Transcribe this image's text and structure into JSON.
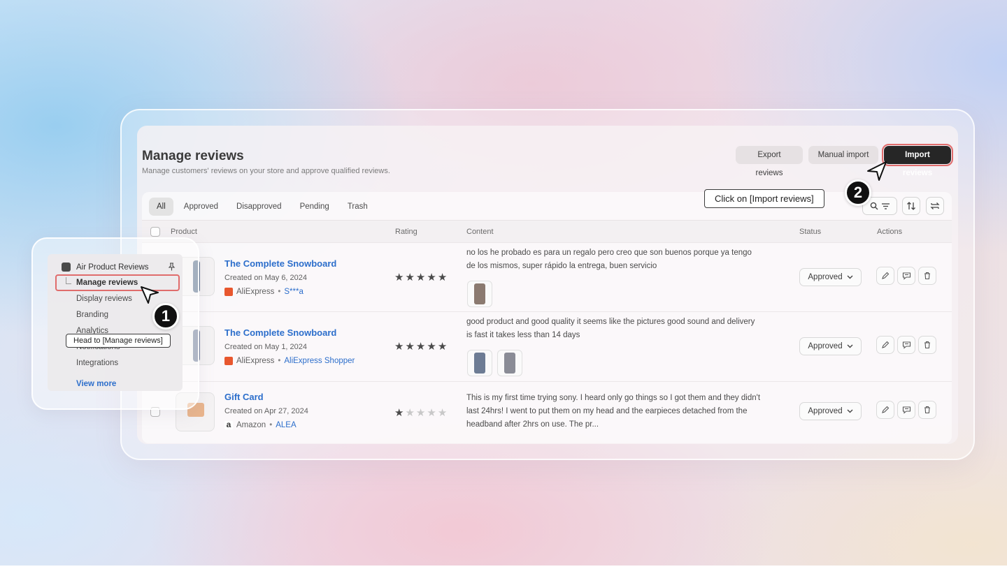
{
  "page": {
    "title": "Manage reviews",
    "subtitle": "Manage customers' reviews on your store and approve qualified reviews."
  },
  "header_actions": {
    "export": "Export reviews",
    "manual": "Manual import",
    "import": "Import reviews"
  },
  "tabs": [
    {
      "label": "All",
      "active": true
    },
    {
      "label": "Approved",
      "active": false
    },
    {
      "label": "Disapproved",
      "active": false
    },
    {
      "label": "Pending",
      "active": false
    },
    {
      "label": "Trash",
      "active": false
    }
  ],
  "table": {
    "columns": {
      "product": "Product",
      "rating": "Rating",
      "content": "Content",
      "status": "Status",
      "actions": "Actions"
    },
    "rows": [
      {
        "product": "The Complete Snowboard",
        "created": "Created on May 6, 2024",
        "source": "AliExpress",
        "author": "S***a",
        "rating": 5,
        "content": "no los he probado es para un regalo pero creo que son buenos porque ya tengo de los mismos, super rápido la entrega, buen servicio",
        "status": "Approved"
      },
      {
        "product": "The Complete Snowboard",
        "created": "Created on May 1, 2024",
        "source": "AliExpress",
        "author": "AliExpress Shopper",
        "rating": 5,
        "content": "good product and good quality it seems like the pictures good sound and delivery is fast it takes less than 14 days",
        "status": "Approved"
      },
      {
        "product": "Gift Card",
        "created": "Created on Apr 27, 2024",
        "source": "Amazon",
        "author": "ALEA",
        "rating": 1,
        "content": "This is my first time trying sony. I heard only go things so I got them and they didn't last 24hrs! I went to put them on my head and the earpieces detached from the headband after 2hrs on use. The pr...",
        "status": "Approved"
      }
    ]
  },
  "nav": {
    "app_name": "Air Product Reviews",
    "items": [
      {
        "label": "Manage reviews",
        "active": true
      },
      {
        "label": "Display reviews",
        "active": false
      },
      {
        "label": "Branding",
        "active": false
      },
      {
        "label": "Analytics",
        "active": false
      },
      {
        "label": "Notifications",
        "active": false
      },
      {
        "label": "Integrations",
        "active": false
      }
    ],
    "view_more": "View more"
  },
  "annotations": {
    "step1_number": "1",
    "step1_text": "Head to [Manage reviews]",
    "step2_number": "2",
    "step2_text": "Click on [Import reviews]"
  },
  "colors": {
    "accent_link": "#2c6ecb",
    "highlight": "#e06c6c",
    "primary_button": "#262626",
    "aliexpress": "#e8572e",
    "amazon": "#333333"
  }
}
